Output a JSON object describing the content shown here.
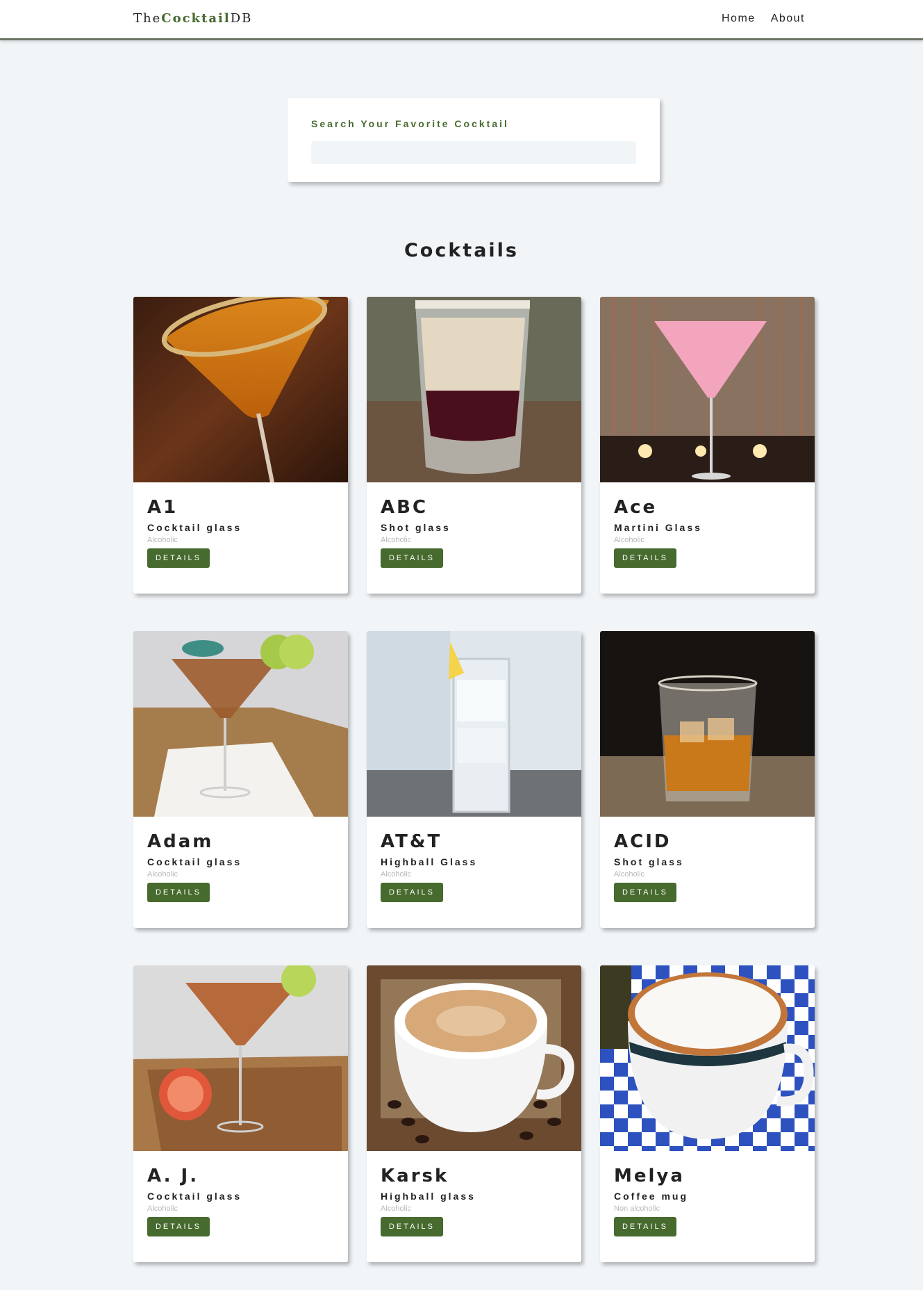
{
  "nav": {
    "logo_prefix": "The",
    "logo_accent": "Cocktail",
    "logo_suffix": "DB",
    "links": [
      "Home",
      "About"
    ]
  },
  "search": {
    "label": "Search Your Favorite Cocktail",
    "value": "",
    "placeholder": ""
  },
  "section_title": "Cocktails",
  "details_label": "DETAILS",
  "cocktails": [
    {
      "name": "A1",
      "glass": "Cocktail glass",
      "type": "Alcoholic"
    },
    {
      "name": "ABC",
      "glass": "Shot glass",
      "type": "Alcoholic"
    },
    {
      "name": "Ace",
      "glass": "Martini Glass",
      "type": "Alcoholic"
    },
    {
      "name": "Adam",
      "glass": "Cocktail glass",
      "type": "Alcoholic"
    },
    {
      "name": "AT&T",
      "glass": "Highball Glass",
      "type": "Alcoholic"
    },
    {
      "name": "ACID",
      "glass": "Shot glass",
      "type": "Alcoholic"
    },
    {
      "name": "A. J.",
      "glass": "Cocktail glass",
      "type": "Alcoholic"
    },
    {
      "name": "Karsk",
      "glass": "Highball glass",
      "type": "Alcoholic"
    },
    {
      "name": "Melya",
      "glass": "Coffee mug",
      "type": "Non alcoholic"
    }
  ],
  "colors": {
    "accent": "#476a2e",
    "background": "#f1f5f8",
    "navbar_border": "#6e7766"
  }
}
